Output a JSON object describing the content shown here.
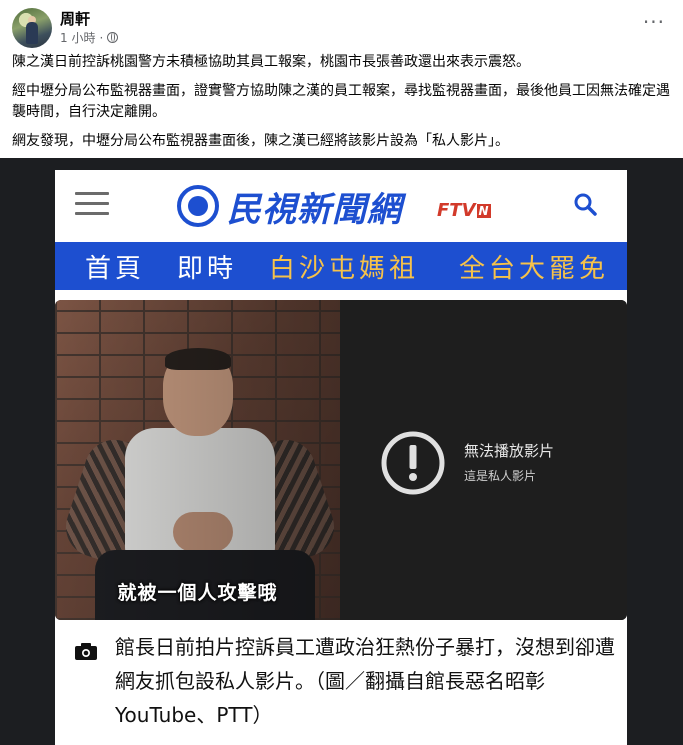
{
  "post": {
    "author": "周軒",
    "time": "1 小時",
    "time_sep": "·",
    "more_label": "···",
    "paragraphs": [
      "陳之漢日前控訴桃園警方未積極協助其員工報案，桃園市長張善政還出來表示震怒。",
      "經中壢分局公布監視器畫面，證實警方協助陳之漢的員工報案，尋找監視器畫面，最後他員工因無法確定遇襲時間，自行決定離開。",
      "網友發現，中壢分局公布監視器畫面後，陳之漢已經將該影片設為「私人影片」。"
    ]
  },
  "site": {
    "logo_text": "民視新聞網",
    "logo_ftv": "FTV",
    "logo_n": "N",
    "nav": [
      "首頁",
      "即時",
      "白沙屯媽祖",
      "全台大罷免"
    ],
    "brand_color": "#1d4fd0",
    "highlight_color": "#f6c24a"
  },
  "video": {
    "subtitle": "就被一個人攻擊哦",
    "unavailable_title": "無法播放影片",
    "unavailable_sub": "這是私人影片"
  },
  "caption": {
    "text": "館長日前拍片控訴員工遭政治狂熱份子暴打，沒想到卻遭網友抓包設私人影片。（圖／翻攝自館長惡名昭彰YouTube、PTT）"
  }
}
